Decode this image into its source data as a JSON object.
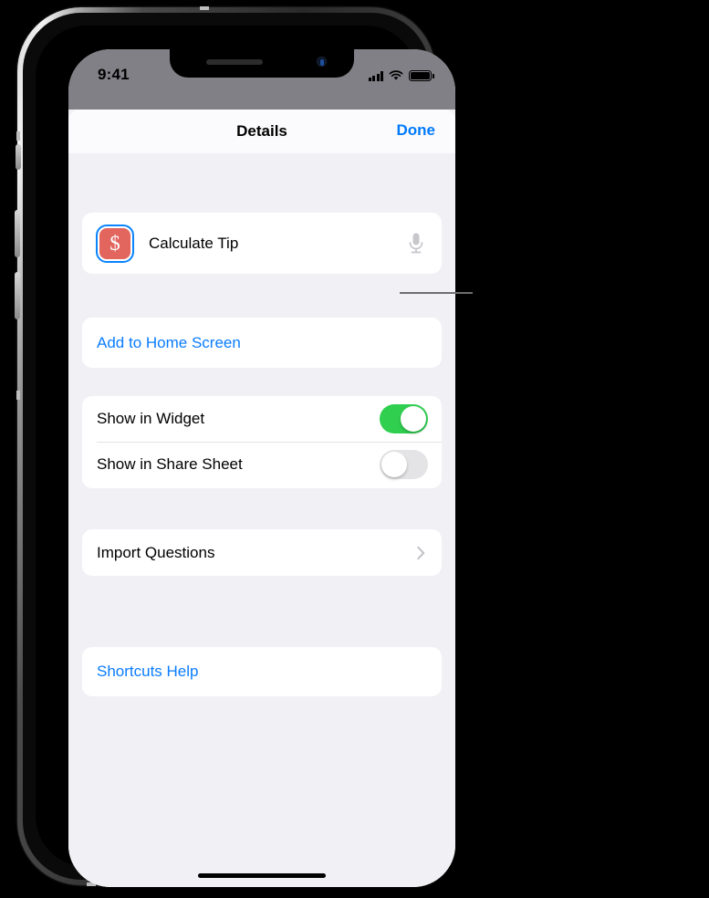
{
  "status_bar": {
    "time": "9:41",
    "icons": [
      "cellular-signal-icon",
      "wifi-icon",
      "battery-icon"
    ]
  },
  "nav_bar": {
    "title": "Details",
    "done_label": "Done"
  },
  "shortcut": {
    "name": "Calculate Tip",
    "icon_glyph": "$",
    "icon_color": "#e2655e",
    "selection_ring_color": "#0a84ff",
    "mic_icon": "microphone-icon"
  },
  "sections": {
    "add_to_home_screen": {
      "label": "Add to Home Screen"
    },
    "toggles": [
      {
        "label": "Show in Widget",
        "state": "on"
      },
      {
        "label": "Show in Share Sheet",
        "state": "off"
      }
    ],
    "import_questions": {
      "label": "Import Questions",
      "accessory": "chevron-right-icon"
    },
    "help": {
      "label": "Shortcuts Help"
    }
  },
  "colors": {
    "accent_blue": "#007aff",
    "link_blue": "#0a7cff",
    "toggle_on_green": "#30cf50",
    "toggle_off_gray": "#e4e4e6",
    "background_gray": "#f1f0f5",
    "status_bar_gray": "#808086"
  }
}
